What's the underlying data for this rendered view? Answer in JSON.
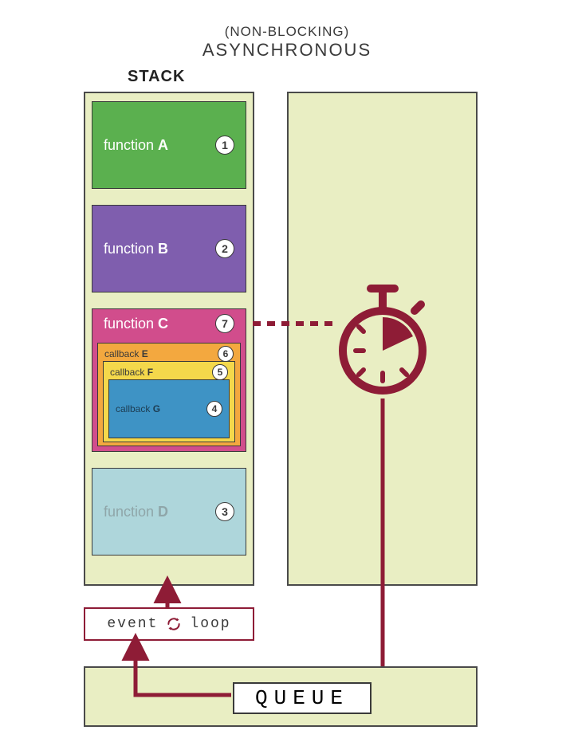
{
  "header": {
    "subtitle": "(NON-BLOCKING)",
    "title": "ASYNCHRONOUS"
  },
  "stack": {
    "label": "STACK",
    "frames": {
      "a": {
        "prefix": "function ",
        "name": "A",
        "order": "1"
      },
      "b": {
        "prefix": "function ",
        "name": "B",
        "order": "2"
      },
      "c": {
        "prefix": "function ",
        "name": "C",
        "order": "7",
        "callbacks": {
          "e": {
            "prefix": "callback ",
            "name": "E",
            "order": "6"
          },
          "f": {
            "prefix": "callback ",
            "name": "F",
            "order": "5"
          },
          "g": {
            "prefix": "callback ",
            "name": "G",
            "order": "4"
          }
        }
      },
      "d": {
        "prefix": "function ",
        "name": "D",
        "order": "3"
      }
    }
  },
  "event_loop": {
    "left": "event",
    "right": "loop"
  },
  "queue": {
    "label": "QUEUE"
  }
}
